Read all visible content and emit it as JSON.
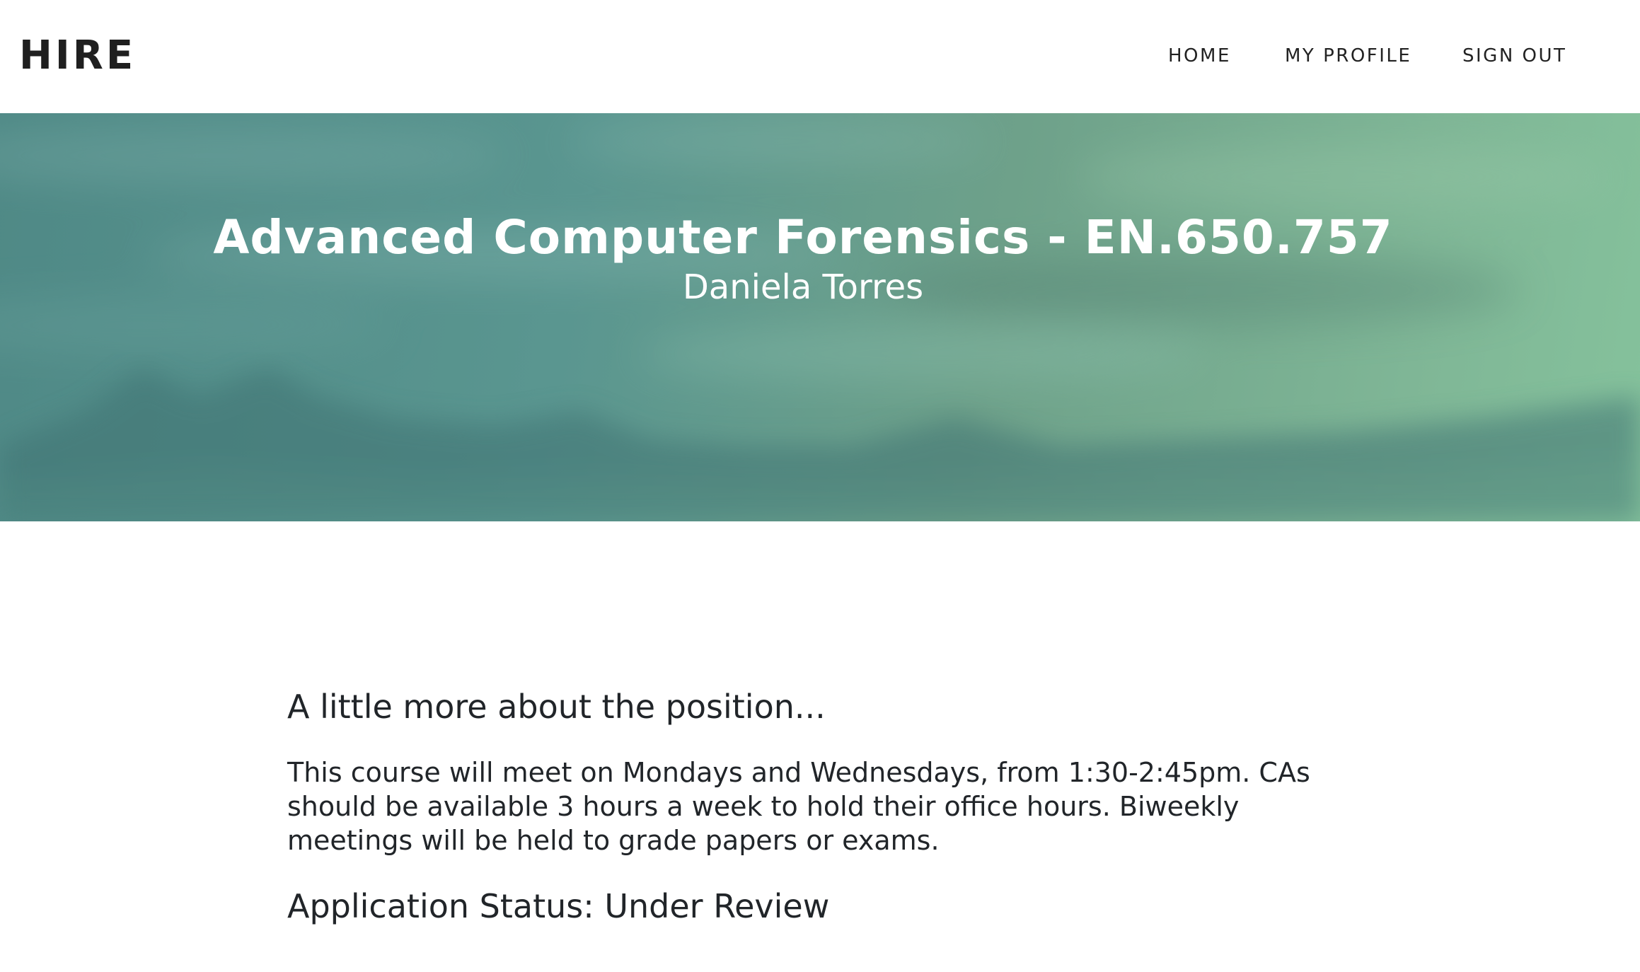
{
  "navbar": {
    "brand": "HIRE",
    "links": {
      "home": "HOME",
      "profile": "MY PROFILE",
      "signout": "SIGN OUT"
    }
  },
  "masthead": {
    "title": "Advanced Computer Forensics - EN.650.757",
    "subtitle": "Daniela Torres"
  },
  "content": {
    "heading": "A little more about the position...",
    "description": "This course will meet on Mondays and Wednesdays, from 1:30-2:45pm. CAs should be available 3 hours a week to hold their office hours. Biweekly meetings will be held to grade papers or exams.",
    "status": "Application Status: Under Review"
  },
  "colors": {
    "text": "#212529",
    "header_teal": "#5a9690",
    "header_green": "#85c29c"
  }
}
